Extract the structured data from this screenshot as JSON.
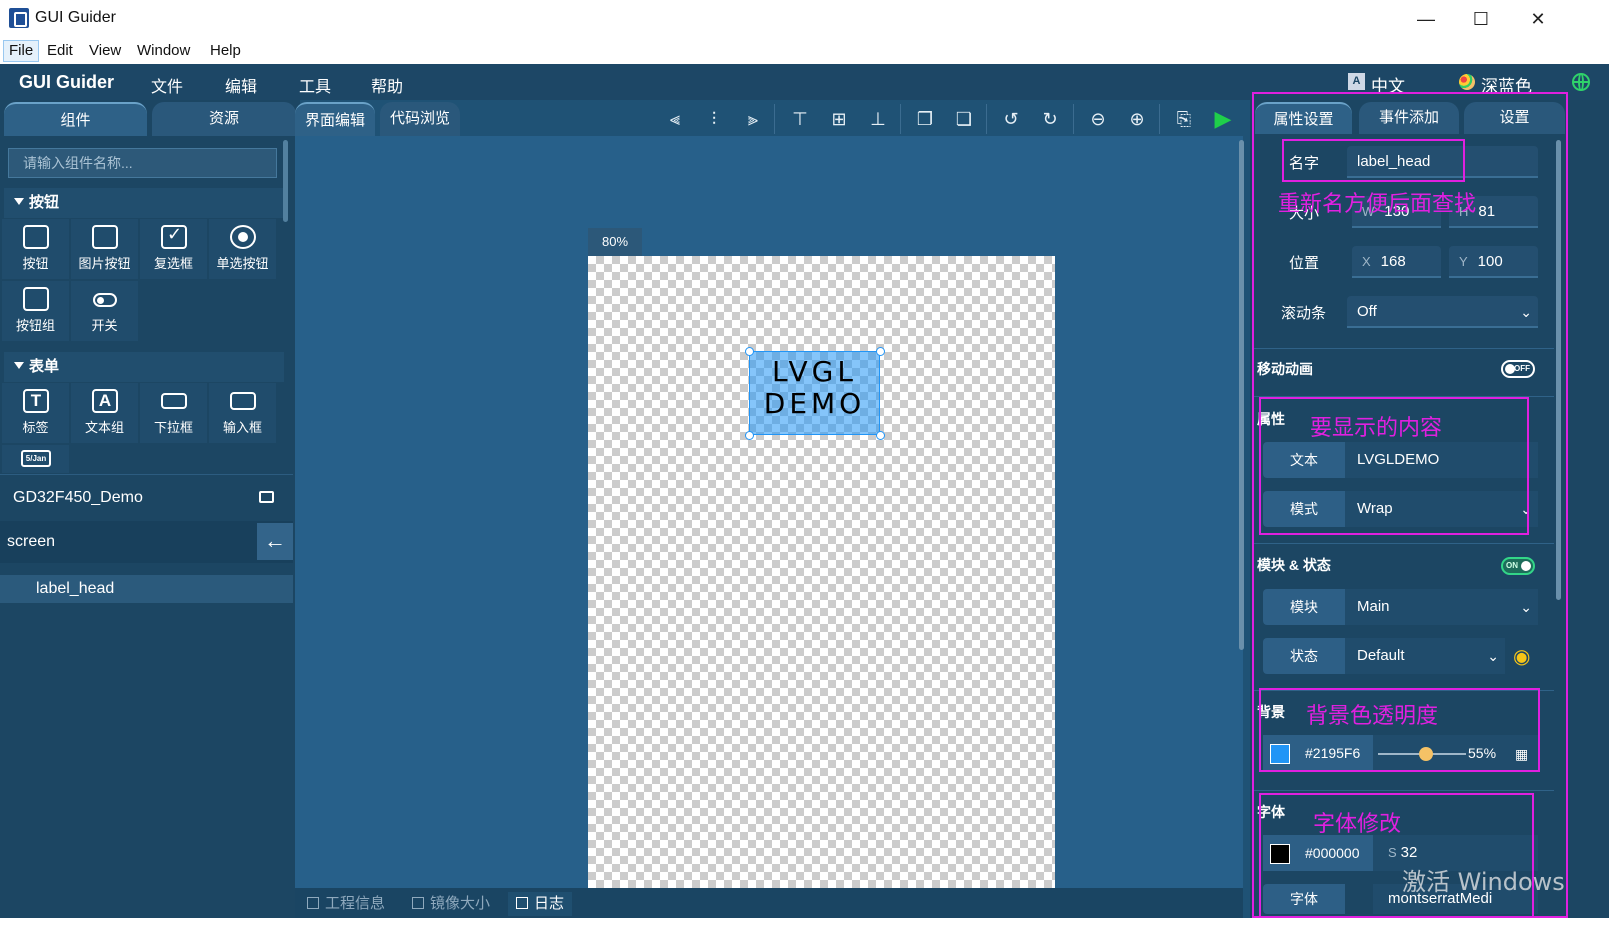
{
  "window": {
    "title": "GUI Guider",
    "min": "—",
    "max": "☐",
    "close": "✕"
  },
  "menubar": [
    "File",
    "Edit",
    "View",
    "Window",
    "Help"
  ],
  "header": {
    "brand": "GUI Guider",
    "menus": [
      "文件",
      "编辑",
      "工具",
      "帮助"
    ],
    "language": "中文",
    "theme": "深蓝色"
  },
  "left": {
    "tabs": {
      "components": "组件",
      "resources": "资源"
    },
    "search_placeholder": "请输入组件名称...",
    "sections": {
      "buttons": {
        "title": "按钮",
        "items": [
          "按钮",
          "图片按钮",
          "复选框",
          "单选按钮",
          "按钮组",
          "开关"
        ]
      },
      "forms": {
        "title": "表单",
        "items": [
          "标签",
          "文本组",
          "下拉框",
          "输入框"
        ],
        "extra": "5/Jan"
      }
    },
    "project": "GD32F450_Demo",
    "screen": "screen",
    "tree_item": "label_head"
  },
  "center": {
    "tabs": {
      "editor": "界面编辑",
      "code": "代码浏览"
    },
    "zoom": "80%",
    "label_text": [
      "LVGL",
      "DEMO"
    ],
    "bottom_tabs": {
      "info": "工程信息",
      "mirror": "镜像大小",
      "log": "日志"
    }
  },
  "right": {
    "tabs": {
      "props": "属性设置",
      "events": "事件添加",
      "settings": "设置"
    },
    "name_label": "名字",
    "name_value": "label_head",
    "size_label": "大小",
    "w_prefix": "W",
    "w_value": "130",
    "h_prefix": "H",
    "h_value": "81",
    "pos_label": "位置",
    "x_prefix": "X",
    "x_value": "168",
    "y_prefix": "Y",
    "y_value": "100",
    "scroll_label": "滚动条",
    "scroll_value": "Off",
    "move_anim": "移动动画",
    "switch_off": "OFF",
    "attr_title": "属性",
    "text_label": "文本",
    "text_value": "LVGLDEMO",
    "mode_label": "模式",
    "mode_value": "Wrap",
    "module_state_title": "模块 & 状态",
    "switch_on": "ON",
    "module_label": "模块",
    "module_value": "Main",
    "state_label": "状态",
    "state_value": "Default",
    "bg_title": "背景",
    "bg_color": "#2195F6",
    "bg_opacity": "55%",
    "bg_opacity_fraction": 0.55,
    "font_title": "字体",
    "font_color": "#000000",
    "font_size_prefix": "S",
    "font_size": "32",
    "font_label": "字体",
    "font_value": "montserratMedi"
  },
  "annotations": {
    "rename": "重新名方便后面查找",
    "content": "要显示的内容",
    "bg": "背景色透明度",
    "font": "字体修改"
  },
  "watermark": "激活 Windows"
}
